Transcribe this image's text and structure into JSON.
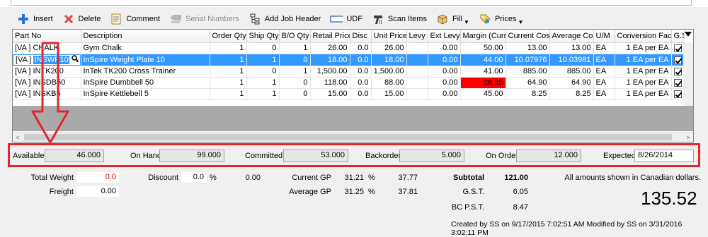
{
  "toolbar": {
    "insert": "Insert",
    "delete": "Delete",
    "comment": "Comment",
    "serial_numbers": "Serial Numbers",
    "add_job_header": "Add Job Header",
    "udf": "UDF",
    "scan_items": "Scan Items",
    "fill": "Fill",
    "prices": "Prices"
  },
  "grid": {
    "columns": [
      "Part No",
      "Description",
      "Order Qty",
      "Ship Qty",
      "B/O Qty",
      "Retail Price",
      "Disc",
      "Unit Price",
      "Levy",
      "Ext Levy",
      "Margin (Curr)",
      "Current Cost",
      "Average Cost",
      "U/M",
      "Conversion Factor",
      "G.S.T."
    ],
    "rows": [
      {
        "loc": "[VA   ]",
        "part": "CHALK",
        "desc": "Gym Chalk",
        "order": "1",
        "ship": "0",
        "bo": "1",
        "retail": "26.00",
        "disc": "0.0",
        "unit": "26.00",
        "levy": "",
        "extlevy": "0.00",
        "margin": "50.00",
        "cur": "13.00",
        "avg": "13.00",
        "um": "EA",
        "conv": "1 EA per EA"
      },
      {
        "loc": "[VA   ]",
        "part": "INSWP10",
        "desc": "InSpire Weight Plate 10",
        "order": "1",
        "ship": "1",
        "bo": "0",
        "retail": "18.00",
        "disc": "0.0",
        "unit": "18.00",
        "levy": "",
        "extlevy": "0.00",
        "margin": "44.00",
        "cur": "10.07976",
        "avg": "10.03981",
        "um": "EA",
        "conv": "1 EA per EA"
      },
      {
        "loc": "[VA   ]",
        "part": "INTK200",
        "desc": "InTek TK200 Cross Trainer",
        "order": "1",
        "ship": "0",
        "bo": "1",
        "retail": "1,500.00",
        "disc": "0.0",
        "unit": "1,500.00",
        "levy": "",
        "extlevy": "0.00",
        "margin": "41.00",
        "cur": "885.00",
        "avg": "885.00",
        "um": "EA",
        "conv": "1 EA per EA"
      },
      {
        "loc": "[VA   ]",
        "part": "INSDB50",
        "desc": "InSpire Dumbbell 50",
        "order": "1",
        "ship": "1",
        "bo": "0",
        "retail": "118.00",
        "disc": "0.0",
        "unit": "88.00",
        "levy": "",
        "extlevy": "0.00",
        "margin": "26.25",
        "cur": "64.90",
        "avg": "64.90",
        "um": "EA",
        "conv": "1 EA per EA"
      },
      {
        "loc": "[VA   ]",
        "part": "INSKB5",
        "desc": "InSpire Kettlebell 5",
        "order": "1",
        "ship": "1",
        "bo": "0",
        "retail": "15.00",
        "disc": "0.0",
        "unit": "15.00",
        "levy": "",
        "extlevy": "0.00",
        "margin": "45.00",
        "cur": "8.25",
        "avg": "8.25",
        "um": "EA",
        "conv": "1 EA per EA"
      }
    ]
  },
  "stock": {
    "available_label": "Available",
    "available": "46.000",
    "onhand_label": "On Hand",
    "onhand": "99.000",
    "committed_label": "Committed",
    "committed": "53.000",
    "backorder_label": "Backorder",
    "backorder": "5.000",
    "onorder_label": "On Order",
    "onorder": "12.000",
    "expected_label": "Expected",
    "expected": "8/26/2014"
  },
  "totals": {
    "total_weight_label": "Total Weight",
    "total_weight": "0.0",
    "freight_label": "Freight",
    "freight": "0.00",
    "discount_label": "Discount",
    "discount_pct": "0.0",
    "pct_sign": "%",
    "discount_amt": "0.00",
    "current_gp_label": "Current GP",
    "current_gp_pct": "31.21",
    "current_gp_sign": "%",
    "current_gp_amt": "37.77",
    "average_gp_label": "Average GP",
    "average_gp_pct": "31.25",
    "average_gp_sign": "%",
    "average_gp_amt": "37.81",
    "subtotal_label": "Subtotal",
    "subtotal": "121.00",
    "gst_label": "G.S.T.",
    "gst": "6.05",
    "pst_label": "BC P.S.T.",
    "pst": "8.47",
    "currency_note": "All amounts shown in Canadian dollars.",
    "grand_total": "135.52"
  },
  "footer": {
    "created": "Created by SS on 9/17/2015 7:02:51 AM",
    "modified": "Modified by SS on 3/31/2016 3:02:11 PM"
  },
  "colors": {
    "highlight": "#e0262f",
    "selection": "#3399ff",
    "margin_alert": "#ff0000"
  }
}
